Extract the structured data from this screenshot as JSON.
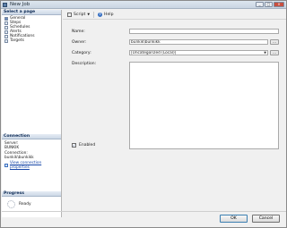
{
  "window": {
    "title": "New Job"
  },
  "sidebar": {
    "select_page_header": "Select a page",
    "pages": [
      {
        "label": "General",
        "icon": "page-icon"
      },
      {
        "label": "Steps",
        "icon": "page-icon"
      },
      {
        "label": "Schedules",
        "icon": "page-icon"
      },
      {
        "label": "Alerts",
        "icon": "page-icon"
      },
      {
        "label": "Notifications",
        "icon": "page-icon"
      },
      {
        "label": "Targets",
        "icon": "page-icon"
      }
    ],
    "connection": {
      "header": "Connection",
      "server_label": "Server:",
      "server_value": "BUNKIK",
      "connection_label": "Connection:",
      "connection_value": "bunkik\\bunkikk",
      "link_text": "View connection properties"
    },
    "progress": {
      "header": "Progress",
      "status": "Ready"
    }
  },
  "toolbar": {
    "script_label": "Script",
    "help_label": "Help"
  },
  "form": {
    "name_label": "Name:",
    "name_value": "",
    "owner_label": "Owner:",
    "owner_value": "bunkik\\bunkikk",
    "category_label": "Category:",
    "category_value": "[Uncategorized (Local)]",
    "description_label": "Description:",
    "enabled_label": "Enabled",
    "enabled_checked": true,
    "browse_label": "..."
  },
  "footer": {
    "ok_label": "OK",
    "cancel_label": "Cancel"
  }
}
